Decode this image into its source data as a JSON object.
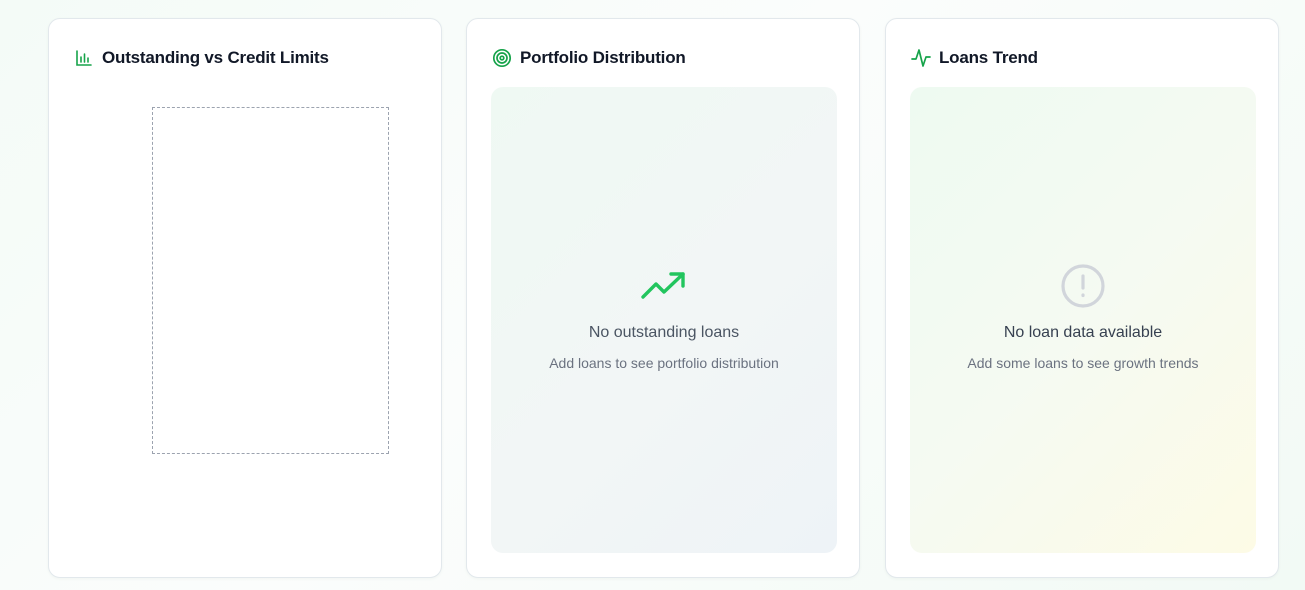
{
  "cards": [
    {
      "title": "Outstanding vs Credit Limits",
      "icon": "bar-chart-icon"
    },
    {
      "title": "Portfolio Distribution",
      "icon": "target-icon",
      "empty_state": {
        "icon": "trending-up-icon",
        "title": "No outstanding loans",
        "subtitle": "Add loans to see portfolio distribution"
      }
    },
    {
      "title": "Loans Trend",
      "icon": "activity-icon",
      "empty_state": {
        "icon": "alert-circle-icon",
        "title": "No loan data available",
        "subtitle": "Add some loans to see growth trends"
      }
    }
  ],
  "colors": {
    "accent_green": "#16a34a",
    "trend_arrow": "#22c55e",
    "alert_gray": "#d1d5db",
    "title_text": "#111827"
  }
}
